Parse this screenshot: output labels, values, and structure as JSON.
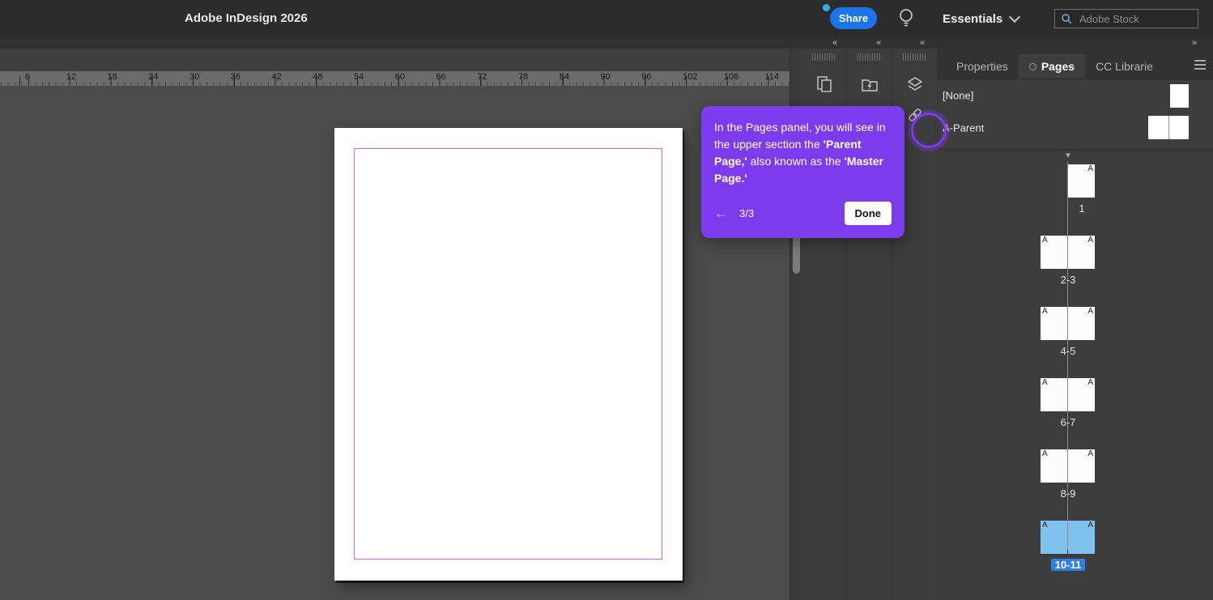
{
  "app": {
    "title": "Adobe InDesign 2026"
  },
  "topbar": {
    "share_label": "Share",
    "workspace_label": "Essentials",
    "search_placeholder": "Adobe Stock"
  },
  "ruler": {
    "labels": [
      "6",
      "12",
      "18",
      "24",
      "30",
      "36",
      "42",
      "48",
      "54",
      "60",
      "66",
      "72",
      "78",
      "84",
      "90",
      "96",
      "102",
      "108",
      "114"
    ]
  },
  "dock_icons": [
    "pages-panel-icon",
    "cc-libraries-icon",
    "character-styles-a-icon",
    "layers-icon",
    "links-icon"
  ],
  "panel": {
    "tabs": [
      {
        "label": "Properties",
        "active": false
      },
      {
        "label": "Pages",
        "active": true
      },
      {
        "label": "CC Librarie",
        "active": false
      }
    ],
    "parents": [
      {
        "label": "[None]",
        "type": "single"
      },
      {
        "label": "A-Parent",
        "type": "spread"
      }
    ],
    "spreads": [
      {
        "label": "1",
        "type": "single",
        "letters": [
          "A"
        ],
        "selected": false
      },
      {
        "label": "2-3",
        "type": "spread",
        "letters": [
          "A",
          "A"
        ],
        "selected": false
      },
      {
        "label": "4-5",
        "type": "spread",
        "letters": [
          "A",
          "A"
        ],
        "selected": false
      },
      {
        "label": "6-7",
        "type": "spread",
        "letters": [
          "A",
          "A"
        ],
        "selected": false
      },
      {
        "label": "8-9",
        "type": "spread",
        "letters": [
          "A",
          "A"
        ],
        "selected": false
      },
      {
        "label": "10-11",
        "type": "spread",
        "letters": [
          "A",
          "A"
        ],
        "selected": true
      }
    ]
  },
  "tooltip": {
    "segments": [
      {
        "text": "In the Pages panel, you will see in the upper section the ",
        "bold": false
      },
      {
        "text": "'Parent Page,'",
        "bold": true
      },
      {
        "text": " also known as the ",
        "bold": false
      },
      {
        "text": "'Master Page.'",
        "bold": true
      }
    ],
    "step": "3/3",
    "done_label": "Done"
  },
  "icons": {
    "search": "magnifier",
    "lightbulb": "bulb",
    "workspace_chevron": "chevron-down",
    "collapse": "«",
    "expand": "»",
    "panel_menu": "hamburger",
    "section_marker": "▾",
    "back": "←"
  },
  "colors": {
    "accent_blue": "#1b74e8",
    "tooltip_purple": "#7d3bee",
    "selection_blue": "#7fc2ee",
    "chip_blue": "#2e7fe0",
    "margin_magenta": "#e05ce0",
    "share_dot": "#2bb3e8"
  }
}
